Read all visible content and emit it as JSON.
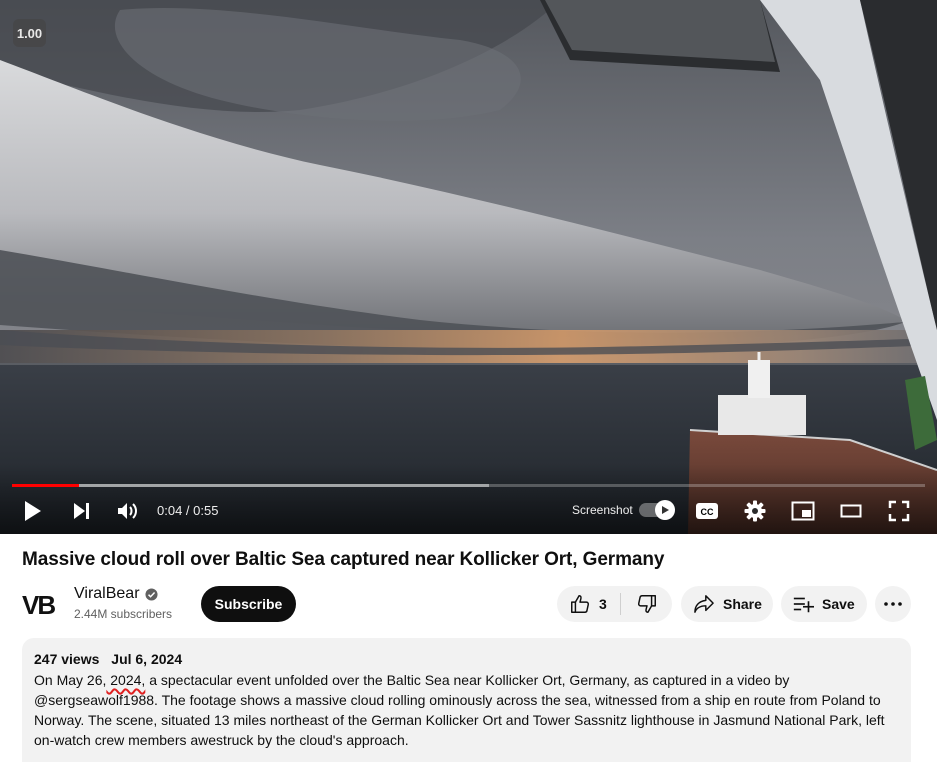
{
  "player": {
    "speed_badge": "1.00",
    "time_current": "0:04",
    "time_separator": " / ",
    "time_total": "0:55",
    "progress_played_fraction": 0.073,
    "progress_buffered_fraction": 0.523,
    "screenshot_label": "Screenshot",
    "screenshot_toggle_on": true,
    "icons": [
      "play-icon",
      "next-icon",
      "volume-icon",
      "cc-icon",
      "settings-gear-icon",
      "miniplayer-icon",
      "theater-mode-icon",
      "fullscreen-icon"
    ],
    "colors": {
      "progress": "#ff0000",
      "controls": "#ffffff"
    }
  },
  "video": {
    "title": "Massive cloud roll over Baltic Sea captured near Kollicker Ort, Germany"
  },
  "channel": {
    "name": "ViralBear",
    "logo_text": "VB",
    "verified": true,
    "subscribers": "2.44M subscribers",
    "subscribe_label": "Subscribe"
  },
  "actions": {
    "like_count": "3",
    "share_label": "Share",
    "save_label": "Save"
  },
  "description": {
    "views": "247 views",
    "date": "Jul 6, 2024",
    "text_before": "On May 26,",
    "text_marked": " 2024,",
    "text_after": " a spectacular event unfolded over the Baltic Sea near Kollicker Ort, Germany, as captured in a video by @sergseawolf1988. The footage shows a massive cloud rolling ominously across the sea, witnessed from a ship en route from Poland to Norway. The scene, situated 13 miles northeast of the German Kollicker Ort and Tower Sassnitz lighthouse in Jasmund National Park, left on-watch crew members awestruck by the cloud's approach."
  }
}
